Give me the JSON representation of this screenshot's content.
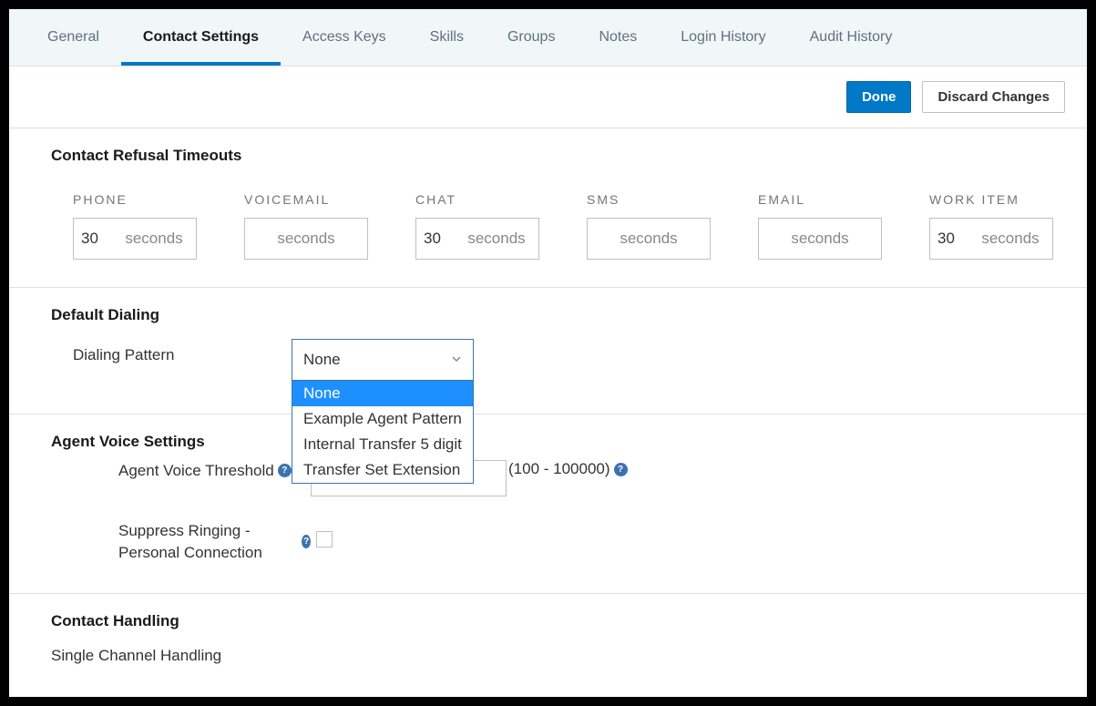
{
  "tabs": {
    "general": "General",
    "contact_settings": "Contact Settings",
    "access_keys": "Access Keys",
    "skills": "Skills",
    "groups": "Groups",
    "notes": "Notes",
    "login_history": "Login History",
    "audit_history": "Audit History"
  },
  "actions": {
    "done": "Done",
    "discard": "Discard Changes"
  },
  "sections": {
    "refusal_title": "Contact Refusal Timeouts",
    "default_dialing_title": "Default Dialing",
    "dialing_pattern_label": "Dialing Pattern",
    "agent_voice_title": "Agent Voice Settings",
    "voice_threshold_label": "Agent Voice Threshold",
    "voice_threshold_range": "(100 - 100000)",
    "suppress_ringing_label": "Suppress Ringing - Personal Connection",
    "contact_handling_title": "Contact Handling",
    "single_channel": "Single Channel Handling"
  },
  "timeouts": {
    "unit": "seconds",
    "phone": {
      "label": "PHONE",
      "value": "30"
    },
    "voicemail": {
      "label": "VOICEMAIL",
      "value": ""
    },
    "chat": {
      "label": "CHAT",
      "value": "30"
    },
    "sms": {
      "label": "SMS",
      "value": ""
    },
    "email": {
      "label": "EMAIL",
      "value": ""
    },
    "work_item": {
      "label": "WORK ITEM",
      "value": "30"
    }
  },
  "dialing_select": {
    "value": "None",
    "options": {
      "none": "None",
      "example_agent": "Example Agent Pattern",
      "internal_transfer": "Internal Transfer 5 digit",
      "transfer_set": "Transfer Set Extension"
    }
  }
}
